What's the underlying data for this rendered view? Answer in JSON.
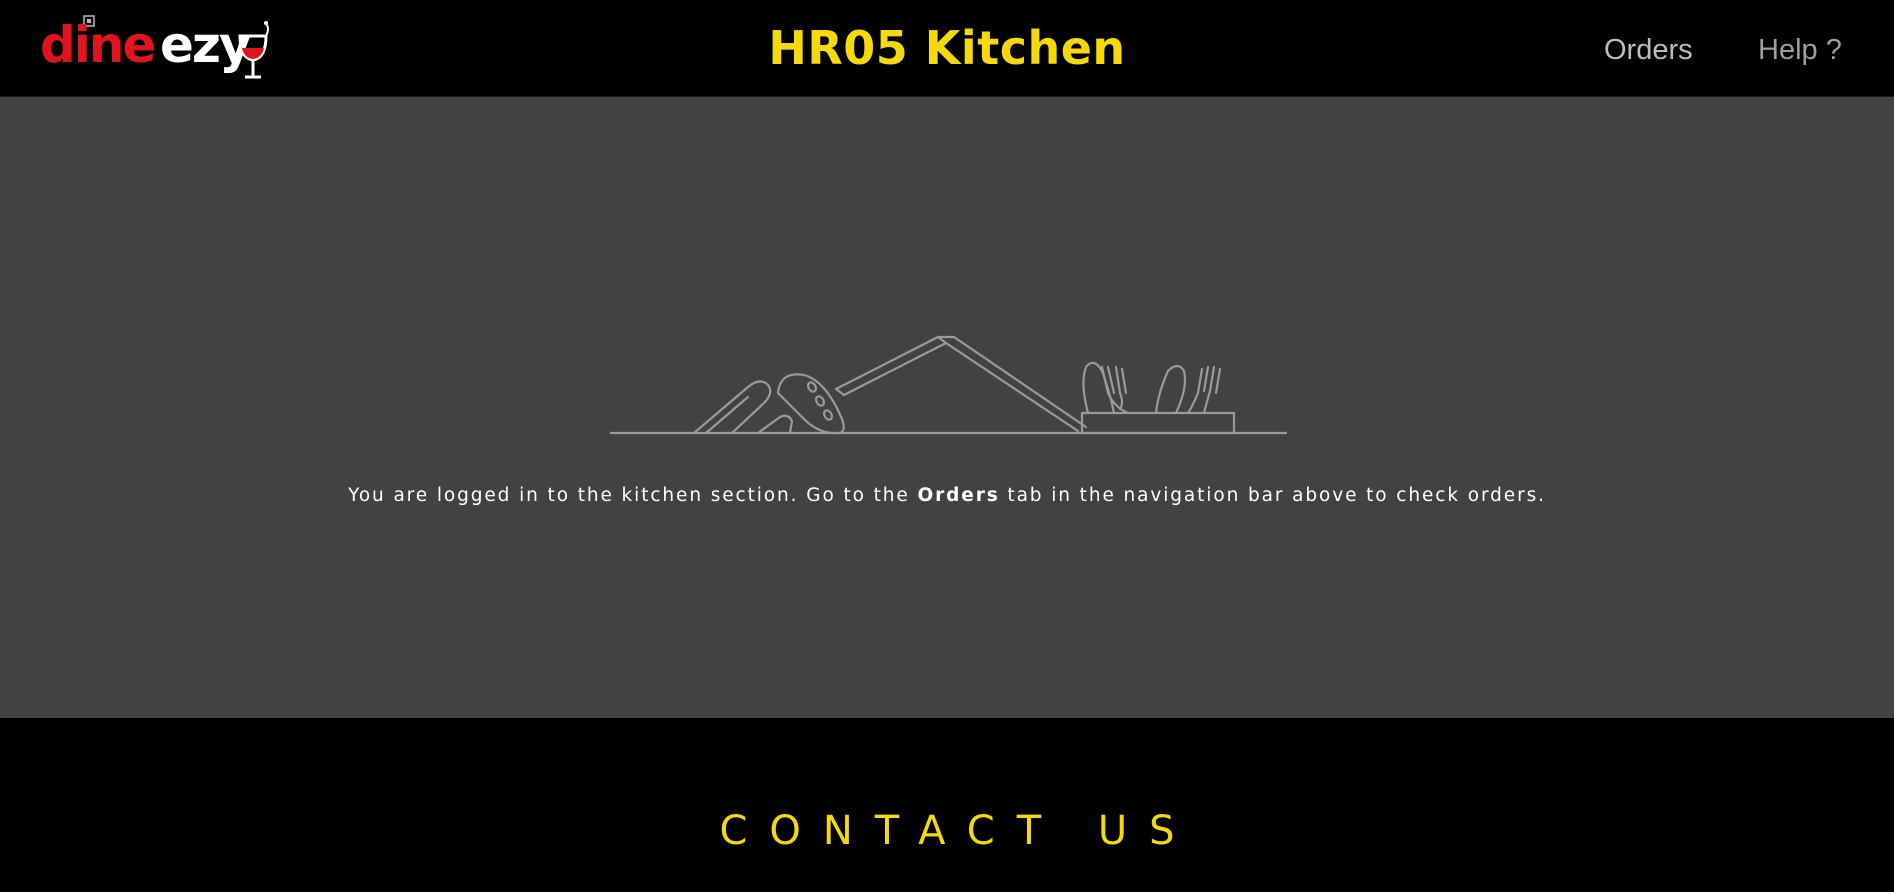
{
  "brand": {
    "name_part1": "dine",
    "name_part2": "ezy",
    "color_red": "#e0141e",
    "color_white": "#ffffff"
  },
  "header": {
    "title": "HR05 Kitchen",
    "title_color": "#f5d90a",
    "nav": {
      "orders_label": "Orders",
      "help_label": "Help ?"
    }
  },
  "main": {
    "background": "#424242",
    "illustration": "empty-kitchen-utensils-illustration",
    "message_before": "You are logged in to the kitchen section. Go to the ",
    "message_emphasis": "Orders",
    "message_after": " tab in the navigation bar above to check orders."
  },
  "footer": {
    "heading": "CONTACT US",
    "heading_color": "#f5d90a"
  }
}
